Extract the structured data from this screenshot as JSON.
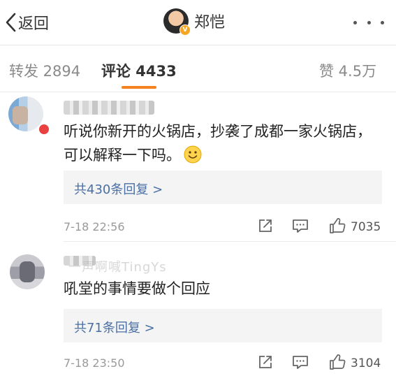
{
  "nav": {
    "back_label": "返回",
    "title": "郑恺",
    "verified_badge": "V"
  },
  "tabs": {
    "repost": "转发 2894",
    "comment": "评论 4433",
    "like": "赞 4.5万"
  },
  "comments": [
    {
      "text": "听说你新开的火锅店，抄袭了成都一家火锅店，可以解释一下吗。",
      "emoji": "smile",
      "replies_label": "共430条回复 >",
      "time": "7-18 22:56",
      "likes": "7035"
    },
    {
      "username_visible": "一声啊喊TingYs",
      "text": "吼堂的事情要做个回应",
      "replies_label": "共71条回复 >",
      "time": "7-18 23:50",
      "likes": "3104"
    }
  ],
  "colors": {
    "accent_underline": "#f58220",
    "reply_link": "#4a6fa5",
    "verified": "#f5a623"
  },
  "icons": [
    "chevron-left-icon",
    "more-dots-icon",
    "smile-emoji-icon",
    "share-icon",
    "comment-icon",
    "like-icon"
  ]
}
